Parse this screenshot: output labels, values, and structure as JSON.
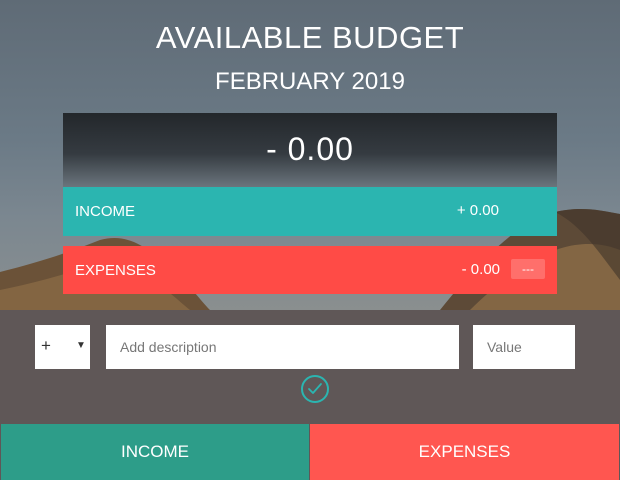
{
  "header": {
    "title": "AVAILABLE BUDGET",
    "month": "FEBRUARY 2019"
  },
  "budget": {
    "value": "- 0.00"
  },
  "income": {
    "label": "INCOME",
    "value": "+ 0.00",
    "color": "#2bb5b0"
  },
  "expenses": {
    "label": "EXPENSES",
    "value": "- 0.00",
    "percentage": "---",
    "color": "#ff4b46"
  },
  "form": {
    "type_selected": "+",
    "description_placeholder": "Add description",
    "value_placeholder": "Value",
    "add_icon": "check-circle-icon"
  },
  "tabs": [
    {
      "label": "INCOME",
      "color": "#2d9d89"
    },
    {
      "label": "EXPENSES",
      "color": "#ff5650"
    }
  ]
}
